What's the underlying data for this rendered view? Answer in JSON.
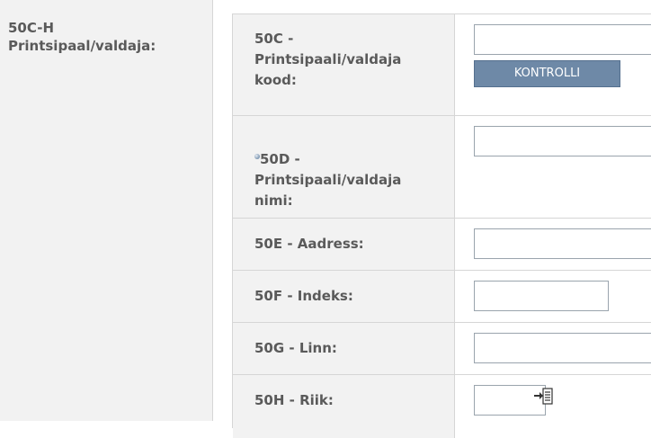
{
  "section": {
    "title": "50C-H\nPrintsipaal/valdaja:"
  },
  "rows": [
    {
      "label": "50C -\nPrintsipaali/valdaja\nkood:",
      "button_label": "KONTROLLI"
    },
    {
      "label": "50D -\nPrintsipaali/valdaja\nnimi:",
      "required_icon": "bullet-icon"
    },
    {
      "label": "50E - Aadress:"
    },
    {
      "label": "50F - Indeks:"
    },
    {
      "label": "50G - Linn:"
    },
    {
      "label": "50H - Riik:",
      "icon": "lookup-list-icon"
    }
  ],
  "colors": {
    "panel_bg": "#f2f2f2",
    "border": "#d6d6d6",
    "text": "#5a5a5a",
    "button_bg": "#6e89a7",
    "input_border": "#9aa4ad"
  }
}
